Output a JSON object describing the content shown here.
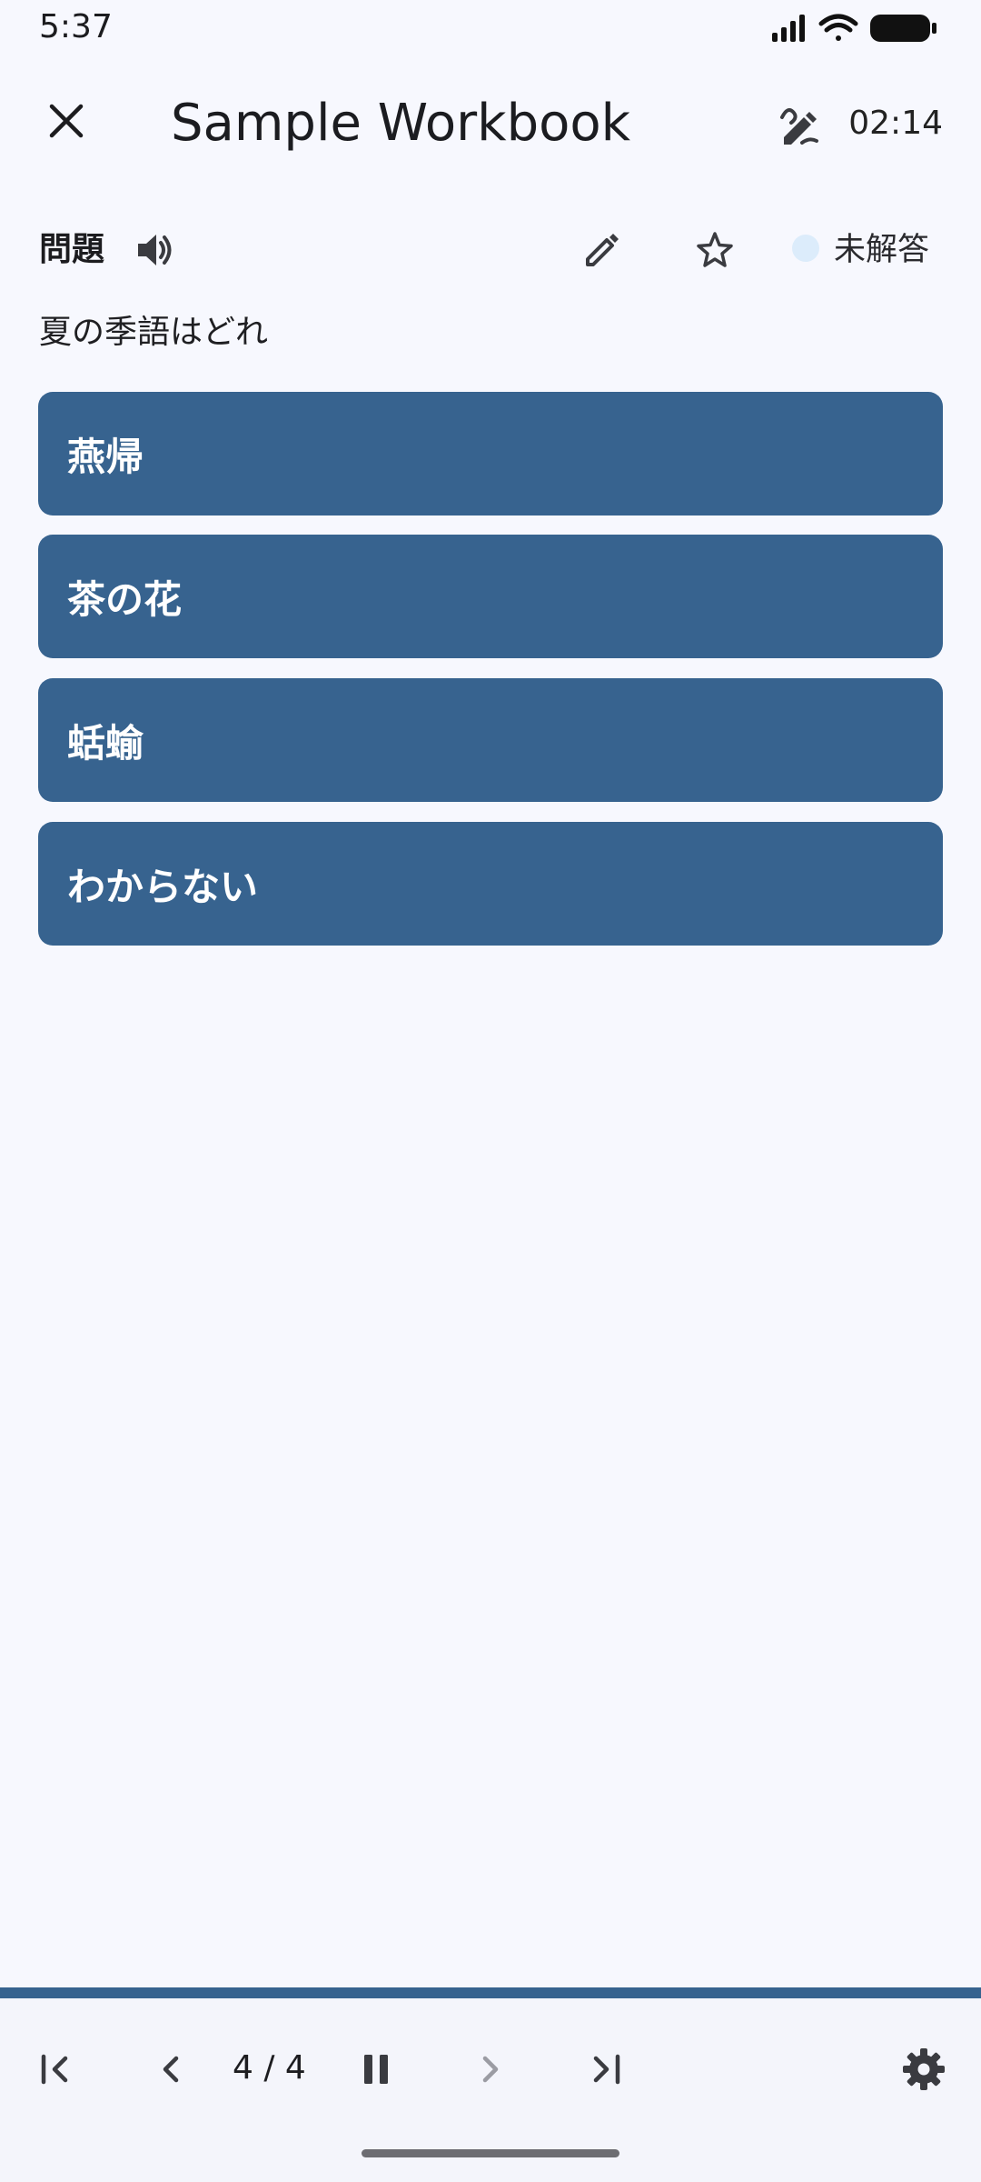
{
  "status_bar": {
    "time": "5:37"
  },
  "app_bar": {
    "title": "Sample Workbook",
    "timer": "02:14"
  },
  "question": {
    "label": "問題",
    "status": "未解答",
    "text": "夏の季語はどれ"
  },
  "choices": [
    {
      "label": "燕帰"
    },
    {
      "label": "茶の花"
    },
    {
      "label": "蛞蝓"
    },
    {
      "label": "わからない"
    }
  ],
  "navigation": {
    "page_indicator": "4 / 4"
  },
  "progress": {
    "fraction": 1.0
  },
  "icons": {
    "close": "close-icon",
    "handwrite": "handwriting-icon",
    "speaker": "speaker-icon",
    "edit": "pencil-icon",
    "star": "star-outline-icon",
    "first": "skip-first-icon",
    "prev": "chevron-left-icon",
    "pause": "pause-icon",
    "next": "chevron-right-icon",
    "last": "skip-last-icon",
    "settings": "gear-icon"
  },
  "colors": {
    "background": "#f7f8fe",
    "choice": "#37638f",
    "choice_text": "#ffffff",
    "status_dot": "#dcecfb",
    "disabled_icon": "#9b9ca3"
  }
}
